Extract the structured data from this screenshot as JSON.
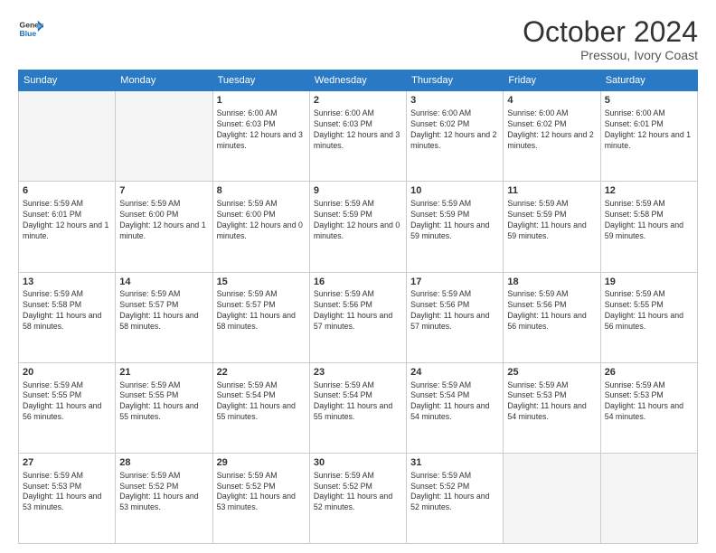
{
  "header": {
    "logo_general": "General",
    "logo_blue": "Blue",
    "month": "October 2024",
    "location": "Pressou, Ivory Coast"
  },
  "weekdays": [
    "Sunday",
    "Monday",
    "Tuesday",
    "Wednesday",
    "Thursday",
    "Friday",
    "Saturday"
  ],
  "weeks": [
    [
      {
        "day": "",
        "empty": true
      },
      {
        "day": "",
        "empty": true
      },
      {
        "day": "1",
        "sr": "6:00 AM",
        "ss": "6:03 PM",
        "dl": "12 hours and 3 minutes."
      },
      {
        "day": "2",
        "sr": "6:00 AM",
        "ss": "6:03 PM",
        "dl": "12 hours and 3 minutes."
      },
      {
        "day": "3",
        "sr": "6:00 AM",
        "ss": "6:02 PM",
        "dl": "12 hours and 2 minutes."
      },
      {
        "day": "4",
        "sr": "6:00 AM",
        "ss": "6:02 PM",
        "dl": "12 hours and 2 minutes."
      },
      {
        "day": "5",
        "sr": "6:00 AM",
        "ss": "6:01 PM",
        "dl": "12 hours and 1 minute."
      }
    ],
    [
      {
        "day": "6",
        "sr": "5:59 AM",
        "ss": "6:01 PM",
        "dl": "12 hours and 1 minute."
      },
      {
        "day": "7",
        "sr": "5:59 AM",
        "ss": "6:00 PM",
        "dl": "12 hours and 1 minute."
      },
      {
        "day": "8",
        "sr": "5:59 AM",
        "ss": "6:00 PM",
        "dl": "12 hours and 0 minutes."
      },
      {
        "day": "9",
        "sr": "5:59 AM",
        "ss": "5:59 PM",
        "dl": "12 hours and 0 minutes."
      },
      {
        "day": "10",
        "sr": "5:59 AM",
        "ss": "5:59 PM",
        "dl": "11 hours and 59 minutes."
      },
      {
        "day": "11",
        "sr": "5:59 AM",
        "ss": "5:59 PM",
        "dl": "11 hours and 59 minutes."
      },
      {
        "day": "12",
        "sr": "5:59 AM",
        "ss": "5:58 PM",
        "dl": "11 hours and 59 minutes."
      }
    ],
    [
      {
        "day": "13",
        "sr": "5:59 AM",
        "ss": "5:58 PM",
        "dl": "11 hours and 58 minutes."
      },
      {
        "day": "14",
        "sr": "5:59 AM",
        "ss": "5:57 PM",
        "dl": "11 hours and 58 minutes."
      },
      {
        "day": "15",
        "sr": "5:59 AM",
        "ss": "5:57 PM",
        "dl": "11 hours and 58 minutes."
      },
      {
        "day": "16",
        "sr": "5:59 AM",
        "ss": "5:56 PM",
        "dl": "11 hours and 57 minutes."
      },
      {
        "day": "17",
        "sr": "5:59 AM",
        "ss": "5:56 PM",
        "dl": "11 hours and 57 minutes."
      },
      {
        "day": "18",
        "sr": "5:59 AM",
        "ss": "5:56 PM",
        "dl": "11 hours and 56 minutes."
      },
      {
        "day": "19",
        "sr": "5:59 AM",
        "ss": "5:55 PM",
        "dl": "11 hours and 56 minutes."
      }
    ],
    [
      {
        "day": "20",
        "sr": "5:59 AM",
        "ss": "5:55 PM",
        "dl": "11 hours and 56 minutes."
      },
      {
        "day": "21",
        "sr": "5:59 AM",
        "ss": "5:55 PM",
        "dl": "11 hours and 55 minutes."
      },
      {
        "day": "22",
        "sr": "5:59 AM",
        "ss": "5:54 PM",
        "dl": "11 hours and 55 minutes."
      },
      {
        "day": "23",
        "sr": "5:59 AM",
        "ss": "5:54 PM",
        "dl": "11 hours and 55 minutes."
      },
      {
        "day": "24",
        "sr": "5:59 AM",
        "ss": "5:54 PM",
        "dl": "11 hours and 54 minutes."
      },
      {
        "day": "25",
        "sr": "5:59 AM",
        "ss": "5:53 PM",
        "dl": "11 hours and 54 minutes."
      },
      {
        "day": "26",
        "sr": "5:59 AM",
        "ss": "5:53 PM",
        "dl": "11 hours and 54 minutes."
      }
    ],
    [
      {
        "day": "27",
        "sr": "5:59 AM",
        "ss": "5:53 PM",
        "dl": "11 hours and 53 minutes."
      },
      {
        "day": "28",
        "sr": "5:59 AM",
        "ss": "5:52 PM",
        "dl": "11 hours and 53 minutes."
      },
      {
        "day": "29",
        "sr": "5:59 AM",
        "ss": "5:52 PM",
        "dl": "11 hours and 53 minutes."
      },
      {
        "day": "30",
        "sr": "5:59 AM",
        "ss": "5:52 PM",
        "dl": "11 hours and 52 minutes."
      },
      {
        "day": "31",
        "sr": "5:59 AM",
        "ss": "5:52 PM",
        "dl": "11 hours and 52 minutes."
      },
      {
        "day": "",
        "empty": true
      },
      {
        "day": "",
        "empty": true
      }
    ]
  ]
}
